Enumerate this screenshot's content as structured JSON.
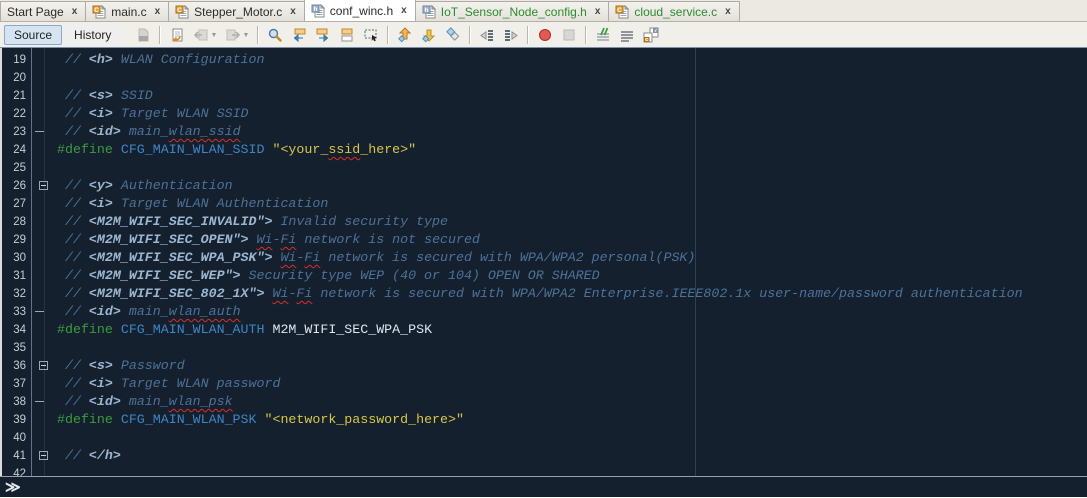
{
  "tabs": [
    {
      "label": "Start Page",
      "icon": null,
      "status": "default",
      "active": false
    },
    {
      "label": "main.c",
      "icon": "c-file",
      "status": "default",
      "active": false
    },
    {
      "label": "Stepper_Motor.c",
      "icon": "c-file",
      "status": "default",
      "active": false
    },
    {
      "label": "conf_winc.h",
      "icon": "h-file",
      "status": "default",
      "active": true
    },
    {
      "label": "IoT_Sensor_Node_config.h",
      "icon": "h-file",
      "status": "new",
      "active": false
    },
    {
      "label": "cloud_service.c",
      "icon": "c-file",
      "status": "new",
      "active": false
    }
  ],
  "tab_close_glyph": "x",
  "toolbar": {
    "source_label": "Source",
    "history_label": "History",
    "items": [
      {
        "icon": "diff",
        "disabled": true
      },
      {
        "sep": true
      },
      {
        "icon": "last-edit",
        "disabled": false
      },
      {
        "icon": "back",
        "disabled": true,
        "dropdown": true
      },
      {
        "icon": "forward",
        "disabled": true,
        "dropdown": true
      },
      {
        "sep": true
      },
      {
        "icon": "find-selection",
        "disabled": false
      },
      {
        "icon": "find-previous",
        "disabled": false
      },
      {
        "icon": "find-next",
        "disabled": false
      },
      {
        "icon": "toggle-highlight-search",
        "disabled": false
      },
      {
        "icon": "rectangular-selection",
        "disabled": false
      },
      {
        "sep": true
      },
      {
        "icon": "previous-bookmark",
        "disabled": false
      },
      {
        "icon": "next-bookmark",
        "disabled": false
      },
      {
        "icon": "toggle-bookmark",
        "disabled": false
      },
      {
        "sep": true
      },
      {
        "icon": "shift-line-left",
        "disabled": false
      },
      {
        "icon": "shift-line-right",
        "disabled": false
      },
      {
        "sep": true
      },
      {
        "icon": "start-macro-recording",
        "disabled": false
      },
      {
        "icon": "stop-macro-recording",
        "disabled": true
      },
      {
        "sep": true
      },
      {
        "icon": "comment",
        "disabled": false
      },
      {
        "icon": "uncomment",
        "disabled": false
      },
      {
        "icon": "toggle-header-source",
        "disabled": false
      }
    ]
  },
  "editor": {
    "margin_column": 80,
    "lines": [
      {
        "num": 19,
        "fold": "",
        "segs": [
          {
            "t": " // ",
            "s": "c"
          },
          {
            "t": "<h>",
            "s": "t"
          },
          {
            "t": " WLAN Configuration",
            "s": "c"
          }
        ]
      },
      {
        "num": 20,
        "fold": "",
        "segs": []
      },
      {
        "num": 21,
        "fold": "",
        "segs": [
          {
            "t": " // ",
            "s": "c"
          },
          {
            "t": "<s>",
            "s": "t"
          },
          {
            "t": " SSID",
            "s": "c"
          }
        ]
      },
      {
        "num": 22,
        "fold": "",
        "segs": [
          {
            "t": " // ",
            "s": "c"
          },
          {
            "t": "<i>",
            "s": "t"
          },
          {
            "t": " Target WLAN SSID",
            "s": "c"
          }
        ]
      },
      {
        "num": 23,
        "fold": "dash",
        "segs": [
          {
            "t": " // ",
            "s": "c"
          },
          {
            "t": "<id>",
            "s": "t"
          },
          {
            "t": " main_",
            "s": "c"
          },
          {
            "t": "wlan_ssid",
            "s": "c",
            "q": true
          }
        ]
      },
      {
        "num": 24,
        "fold": "",
        "segs": [
          {
            "t": "#define",
            "s": "d"
          },
          {
            "t": " ",
            "s": "p"
          },
          {
            "t": "CFG_MAIN_WLAN_SSID",
            "s": "m"
          },
          {
            "t": " ",
            "s": "p"
          },
          {
            "t": "\"<your_",
            "s": "s"
          },
          {
            "t": "ssid",
            "s": "s",
            "q": true
          },
          {
            "t": "_here>\"",
            "s": "s"
          }
        ]
      },
      {
        "num": 25,
        "fold": "",
        "segs": []
      },
      {
        "num": 26,
        "fold": "box",
        "segs": [
          {
            "t": " // ",
            "s": "c"
          },
          {
            "t": "<y>",
            "s": "t"
          },
          {
            "t": " Authentication",
            "s": "c"
          }
        ]
      },
      {
        "num": 27,
        "fold": "",
        "segs": [
          {
            "t": " // ",
            "s": "c"
          },
          {
            "t": "<i>",
            "s": "t"
          },
          {
            "t": " Target WLAN Authentication",
            "s": "c"
          }
        ]
      },
      {
        "num": 28,
        "fold": "",
        "segs": [
          {
            "t": " // ",
            "s": "c"
          },
          {
            "t": "<M2M_WIFI_SEC_INVALID\">",
            "s": "t"
          },
          {
            "t": " Invalid security type",
            "s": "c"
          }
        ]
      },
      {
        "num": 29,
        "fold": "",
        "segs": [
          {
            "t": " // ",
            "s": "c"
          },
          {
            "t": "<M2M_WIFI_SEC_OPEN\">",
            "s": "t"
          },
          {
            "t": " ",
            "s": "c"
          },
          {
            "t": "Wi",
            "s": "c",
            "q": true
          },
          {
            "t": "-",
            "s": "c"
          },
          {
            "t": "Fi",
            "s": "c",
            "q": true
          },
          {
            "t": " network is not secured",
            "s": "c"
          }
        ]
      },
      {
        "num": 30,
        "fold": "",
        "segs": [
          {
            "t": " // ",
            "s": "c"
          },
          {
            "t": "<M2M_WIFI_SEC_WPA_PSK\">",
            "s": "t"
          },
          {
            "t": " ",
            "s": "c"
          },
          {
            "t": "Wi",
            "s": "c",
            "q": true
          },
          {
            "t": "-",
            "s": "c"
          },
          {
            "t": "Fi",
            "s": "c",
            "q": true
          },
          {
            "t": " network is secured with WPA/WPA2 personal(PSK)",
            "s": "c"
          }
        ]
      },
      {
        "num": 31,
        "fold": "",
        "segs": [
          {
            "t": " // ",
            "s": "c"
          },
          {
            "t": "<M2M_WIFI_SEC_WEP\">",
            "s": "t"
          },
          {
            "t": " Security type WEP (40 or 104) OPEN OR SHARED",
            "s": "c"
          }
        ]
      },
      {
        "num": 32,
        "fold": "",
        "segs": [
          {
            "t": " // ",
            "s": "c"
          },
          {
            "t": "<M2M_WIFI_SEC_802_1X\">",
            "s": "t"
          },
          {
            "t": " ",
            "s": "c"
          },
          {
            "t": "Wi",
            "s": "c",
            "q": true
          },
          {
            "t": "-",
            "s": "c"
          },
          {
            "t": "Fi",
            "s": "c",
            "q": true
          },
          {
            "t": " network is secured with WPA/WPA2 Enterprise.IEEE802.1x user-name/password authentication",
            "s": "c"
          }
        ]
      },
      {
        "num": 33,
        "fold": "dash",
        "segs": [
          {
            "t": " // ",
            "s": "c"
          },
          {
            "t": "<id>",
            "s": "t"
          },
          {
            "t": " main_",
            "s": "c"
          },
          {
            "t": "wlan_auth",
            "s": "c",
            "q": true
          }
        ]
      },
      {
        "num": 34,
        "fold": "",
        "segs": [
          {
            "t": "#define",
            "s": "d"
          },
          {
            "t": " ",
            "s": "p"
          },
          {
            "t": "CFG_MAIN_WLAN_AUTH",
            "s": "m"
          },
          {
            "t": " M2M_WIFI_SEC_WPA_PSK",
            "s": "p"
          }
        ]
      },
      {
        "num": 35,
        "fold": "",
        "segs": []
      },
      {
        "num": 36,
        "fold": "box",
        "segs": [
          {
            "t": " // ",
            "s": "c"
          },
          {
            "t": "<s>",
            "s": "t"
          },
          {
            "t": " Password",
            "s": "c"
          }
        ]
      },
      {
        "num": 37,
        "fold": "",
        "segs": [
          {
            "t": " // ",
            "s": "c"
          },
          {
            "t": "<i>",
            "s": "t"
          },
          {
            "t": " Target WLAN password",
            "s": "c"
          }
        ]
      },
      {
        "num": 38,
        "fold": "dash",
        "segs": [
          {
            "t": " // ",
            "s": "c"
          },
          {
            "t": "<id>",
            "s": "t"
          },
          {
            "t": " main_",
            "s": "c"
          },
          {
            "t": "wlan_psk",
            "s": "c",
            "q": true
          }
        ]
      },
      {
        "num": 39,
        "fold": "",
        "segs": [
          {
            "t": "#define",
            "s": "d"
          },
          {
            "t": " ",
            "s": "p"
          },
          {
            "t": "CFG_MAIN_WLAN_PSK",
            "s": "m"
          },
          {
            "t": " ",
            "s": "p"
          },
          {
            "t": "\"<network_password_here>\"",
            "s": "s"
          }
        ]
      },
      {
        "num": 40,
        "fold": "",
        "segs": []
      },
      {
        "num": 41,
        "fold": "box",
        "segs": [
          {
            "t": " // ",
            "s": "c"
          },
          {
            "t": "</h>",
            "s": "t"
          }
        ]
      },
      {
        "num": 42,
        "fold": "",
        "segs": []
      }
    ]
  },
  "breadcrumb": {
    "expand_glyph": "≫"
  },
  "colors": {
    "editor_bg": "#14202E",
    "gutter_text": "#C5CDD5",
    "comment": "#4E7198",
    "tag": "#9CB6D0",
    "define": "#3C9B40",
    "macro": "#3E86C6",
    "string": "#D6C844",
    "plain": "#DEE6EE",
    "squiggle": "#D93025",
    "margin_line": "#2C4156",
    "selected_toggle_bg": "#D6E4F2",
    "tab_active_bg": "#FFFFFF",
    "tabbar_bg": "#ECE9E2",
    "toolbar_bg": "#F1EFEA",
    "new_file_tab_text": "#2E8B2E"
  }
}
